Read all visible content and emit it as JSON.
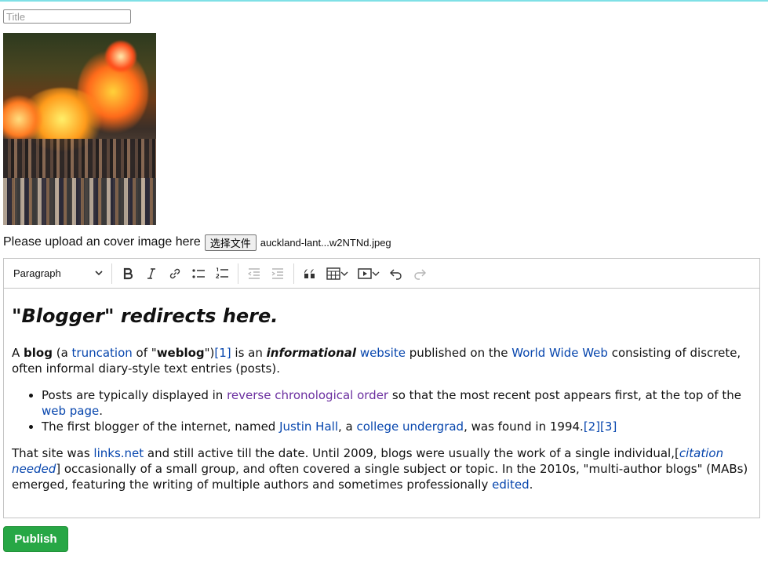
{
  "title_input": {
    "placeholder": "Title",
    "value": ""
  },
  "upload": {
    "label": "Please upload an cover image here",
    "button_label": "选择文件",
    "file_name": "auckland-lant...w2NTNd.jpeg"
  },
  "toolbar": {
    "block_format": "Paragraph",
    "icons": [
      "chevron-down-icon",
      "bold-icon",
      "italic-icon",
      "link-icon",
      "bulleted-list-icon",
      "numbered-list-icon",
      "outdent-icon",
      "indent-icon",
      "blockquote-icon",
      "table-icon",
      "media-icon",
      "undo-icon",
      "redo-icon"
    ]
  },
  "content": {
    "heading": "\"Blogger\" redirects here.",
    "p1": {
      "t1": "A ",
      "b1": "blog",
      "t2": " (a ",
      "l_truncation": "truncation",
      "t3": " of \"",
      "b2": "weblog",
      "t4": "\")",
      "l_ref1": "[1]",
      "t5": " is an ",
      "bi1": "informational",
      "t6": " ",
      "l_website": "website",
      "t7": " published on the ",
      "l_www": "World Wide Web",
      "t8": " consisting of discrete, often informal diary-style text entries (posts)."
    },
    "li1": {
      "t1": "Posts are typically displayed in ",
      "l_rco": "reverse chronological order",
      "t2": " so that the most recent post appears first, at the top of the ",
      "l_webpage": "web page",
      "t3": "."
    },
    "li2": {
      "t1": "The first blogger of the internet, named ",
      "l_justin": "Justin Hall",
      "t2": ", a ",
      "l_college": "college undergrad",
      "t3": ", was found in 1994.",
      "l_ref23": "[2][3]"
    },
    "p2": {
      "t1": "That site was ",
      "l_links": "links.net",
      "t2": " and still active till the date. Until 2009, blogs were usually the work of a single individual,[",
      "l_citation": "citation needed",
      "t3": "] occasionally of a small group, and often covered a single subject or topic. In the 2010s, \"multi-author blogs\" (MABs) emerged, featuring the writing of multiple authors and sometimes professionally ",
      "l_edited": "edited",
      "t4": "."
    }
  },
  "publish_label": "Publish",
  "colors": {
    "accent_green": "#27a745",
    "link": "#0645ad",
    "visited_link": "#6b2fa0",
    "top_border": "#7fe0e6"
  }
}
